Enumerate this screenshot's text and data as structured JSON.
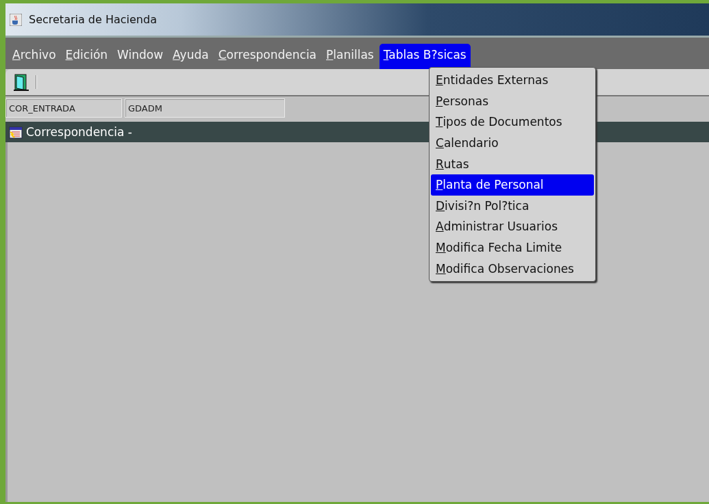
{
  "window": {
    "title": "Secretaria de Hacienda"
  },
  "menu_bar": [
    {
      "label": "Archivo",
      "mnemonic": true,
      "selected": false
    },
    {
      "label": "Edición",
      "mnemonic": true,
      "selected": false
    },
    {
      "label": "Window",
      "mnemonic": false,
      "selected": false
    },
    {
      "label": "Ayuda",
      "mnemonic": true,
      "selected": false
    },
    {
      "label": "Correspondencia",
      "mnemonic": true,
      "selected": false
    },
    {
      "label": "Planillas",
      "mnemonic": true,
      "selected": false
    },
    {
      "label": "Tablas B?sicas",
      "mnemonic": true,
      "selected": true
    }
  ],
  "dropdown": [
    {
      "label": "Entidades Externas",
      "selected": false
    },
    {
      "label": "Personas",
      "selected": false
    },
    {
      "label": "Tipos de Documentos",
      "selected": false
    },
    {
      "label": "Calendario",
      "selected": false
    },
    {
      "label": "Rutas",
      "selected": false
    },
    {
      "label": "Planta de Personal",
      "selected": true
    },
    {
      "label": "Divisi?n Pol?tica",
      "selected": false
    },
    {
      "label": "Administrar Usuarios",
      "selected": false
    },
    {
      "label": "Modifica Fecha Limite",
      "selected": false
    },
    {
      "label": "Modifica Observaciones",
      "selected": false
    }
  ],
  "status_fields": [
    "COR_ENTRADA",
    "GDADM"
  ],
  "inner_window": {
    "title": "Correspondencia -"
  }
}
